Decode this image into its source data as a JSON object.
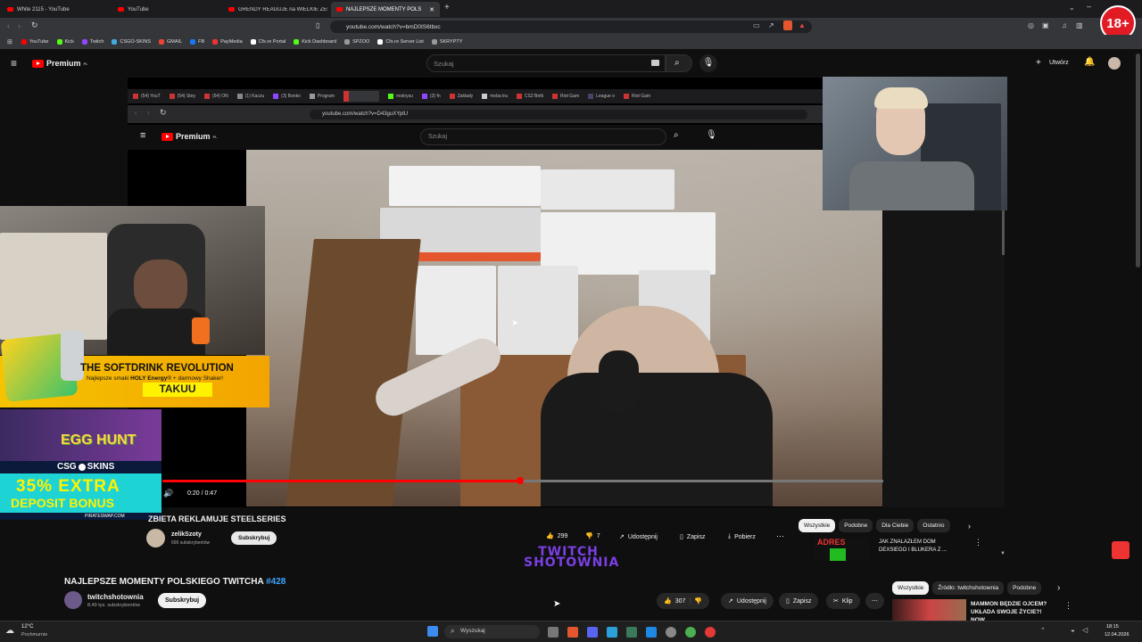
{
  "browser": {
    "tabs": [
      {
        "label": "White 2115 - YouTube"
      },
      {
        "label": "YouTube"
      },
      {
        "label": "GRENDY REAGUJE na WIELKIE ZERW"
      },
      {
        "label": "NAJLEPSZE MOMENTY POLS"
      }
    ],
    "new_tab": "+",
    "url": "youtube.com/watch?v=bmD0IS6tbxc",
    "bookmarks": [
      "YouTube",
      "Kick",
      "Twitch",
      "CSGO-SKINS",
      "GMAIL",
      "FB",
      "PayMedia",
      "Cfx.re Portal",
      "Kick Dashboard",
      "SPZOO",
      "Cfx.re Server List",
      "SKRYPTY"
    ]
  },
  "youtube": {
    "logo_text": "Premium",
    "logo_sup": "PL",
    "search_placeholder": "Szukaj",
    "create_label": "Utwórz",
    "badge_18": "18+"
  },
  "inner": {
    "tabs": [
      "(54) YouT",
      "(54) Stey",
      "(54) ON",
      "(1) Kaczu",
      "(3) Bonko",
      "Program",
      "",
      "mokrysu",
      "(3) fn",
      "Zakłady",
      "moba tra",
      "CS2 Betti",
      "Riot Gam",
      "League o",
      "Riot Gam"
    ],
    "url": "youtube.com/watch?v=D43guXYptU",
    "logo_text": "Premium",
    "logo_sup": "PL",
    "search_placeholder": "Szukaj",
    "video_title": "ZBIETA REKLAMUJE STEELSERIES",
    "channel": "zelikSzoty",
    "subs": "699 subskrybentów",
    "subscribe": "Subskrybuj",
    "likes": "299",
    "dislikes": "7",
    "share": "Udostępnij",
    "save": "Zapisz",
    "download": "Pobierz",
    "time": "0:20 / 0:47",
    "progress": 0.43,
    "chips": [
      "Wszystkie",
      "Podobne",
      "Dla Ciebie",
      "Ostatnio"
    ],
    "rec_title": "JAK ZNALAZŁEM DOM DEXSIEGO I BLUKERA Z ...",
    "rec_thumb": "ADRES"
  },
  "overlay": {
    "banner_title": "THE SOFTDRINK REVOLUTION",
    "banner_sub_prefix": "Najlepsze smaki ",
    "banner_sub_bold": "HOLY Energy",
    "banner_sub_suffix": "® + darmowy Shaker!",
    "banner_code": "TAKUU",
    "egg_hunt": "EGG HUNT",
    "csgo": "CSG",
    "csgo2": "SKINS",
    "extra": "35% EXTRA",
    "deposit": "DEPOSIT BONUS",
    "pirate": "PIRATESWAP.COM",
    "watermark_1": "TWITCH",
    "watermark_2": "SHOTOWNIA"
  },
  "main": {
    "title": "NAJLEPSZE MOMENTY POLSKIEGO TWITCHA ",
    "hashtag": "#428",
    "channel": "twitchshotownia",
    "subs": "8,49 tys. subskrybentów",
    "subscribe": "Subskrybuj",
    "likes": "307",
    "share": "Udostępnij",
    "save": "Zapisz",
    "clip": "Klip",
    "chips": [
      "Wszystkie",
      "Źródło: twitchshotownia",
      "Podobne"
    ],
    "rec_title": "MAMMON BĘDZIE OJCEM? UKŁADA SWOJE ŻYCIE?! NOW..."
  },
  "taskbar": {
    "weather_temp": "12°C",
    "weather_desc": "Pochmurnie",
    "search": "Wyszukaj",
    "time": "18:15",
    "date": "12.04.2026"
  }
}
